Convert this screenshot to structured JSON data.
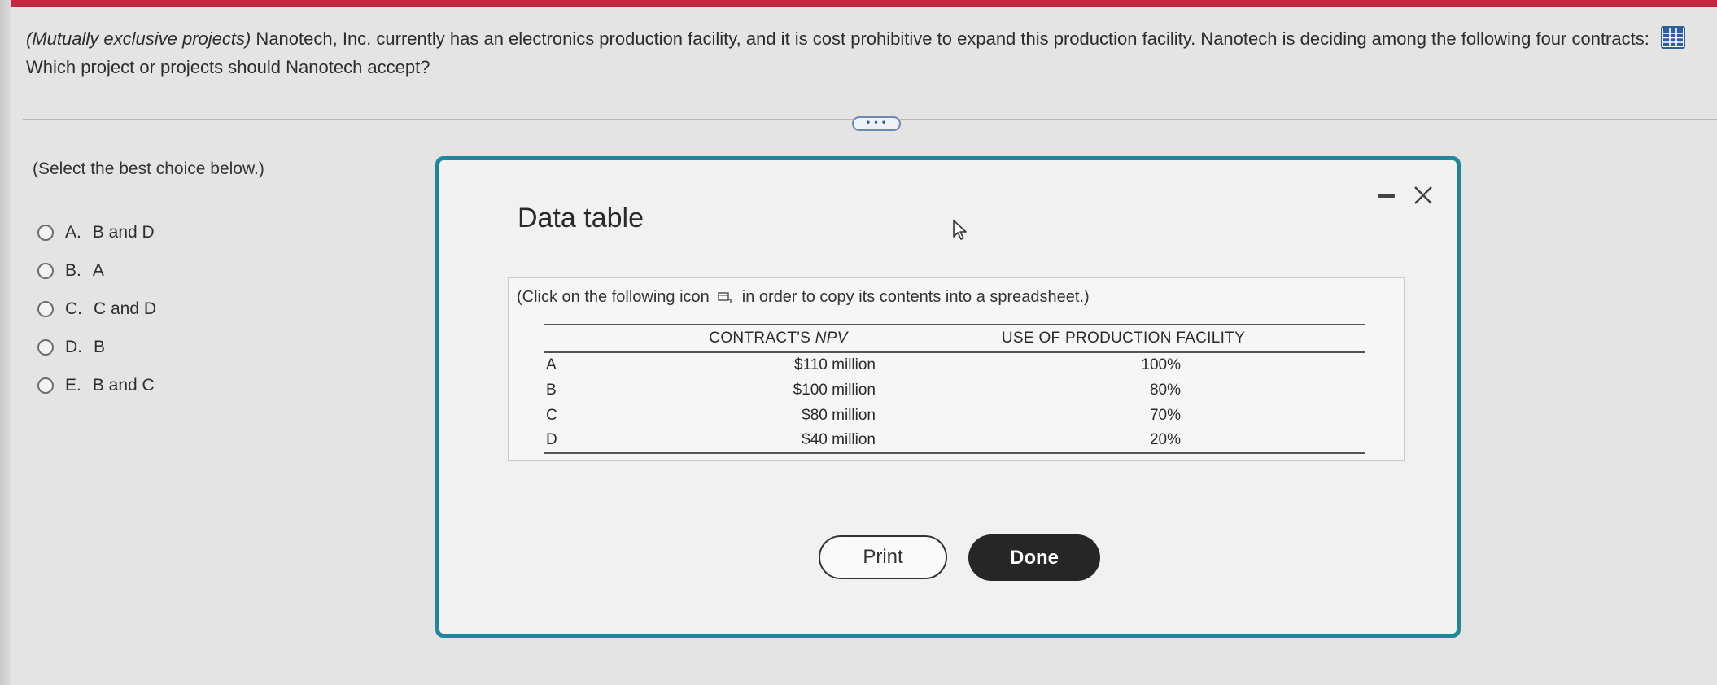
{
  "question": {
    "prefix_italic": "(Mutually exclusive projects)",
    "text": " Nanotech, Inc. currently has an electronics production facility, and it is cost prohibitive to expand this production facility. Nanotech is deciding among the following four contracts:",
    "line2": "Which project or projects should Nanotech accept?"
  },
  "instruction": "(Select the best choice below.)",
  "options": [
    {
      "letter": "A.",
      "text": "B and D"
    },
    {
      "letter": "B.",
      "text": "A"
    },
    {
      "letter": "C.",
      "text": "C and D"
    },
    {
      "letter": "D.",
      "text": "B"
    },
    {
      "letter": "E.",
      "text": "B and C"
    }
  ],
  "more_pill": "• • •",
  "modal": {
    "title": "Data table",
    "copy_note_before": "(Click on the following icon",
    "copy_note_after": "in order to copy its contents into a spreadsheet.)",
    "table": {
      "headers": [
        "",
        "CONTRACT'S NPV",
        "USE OF PRODUCTION FACILITY"
      ],
      "rows": [
        {
          "label": "A",
          "npv": "$110 million",
          "use": "100%"
        },
        {
          "label": "B",
          "npv": "$100 million",
          "use": "80%"
        },
        {
          "label": "C",
          "npv": "$80 million",
          "use": "70%"
        },
        {
          "label": "D",
          "npv": "$40 million",
          "use": "20%"
        }
      ]
    },
    "print_label": "Print",
    "done_label": "Done"
  },
  "colors": {
    "accent": "#20869c",
    "top_strip": "#c42840",
    "done_bg": "#262626"
  },
  "icons": [
    "table-grid-icon",
    "copy-to-spreadsheet-icon",
    "minimize-icon",
    "close-icon",
    "mouse-cursor-icon"
  ]
}
